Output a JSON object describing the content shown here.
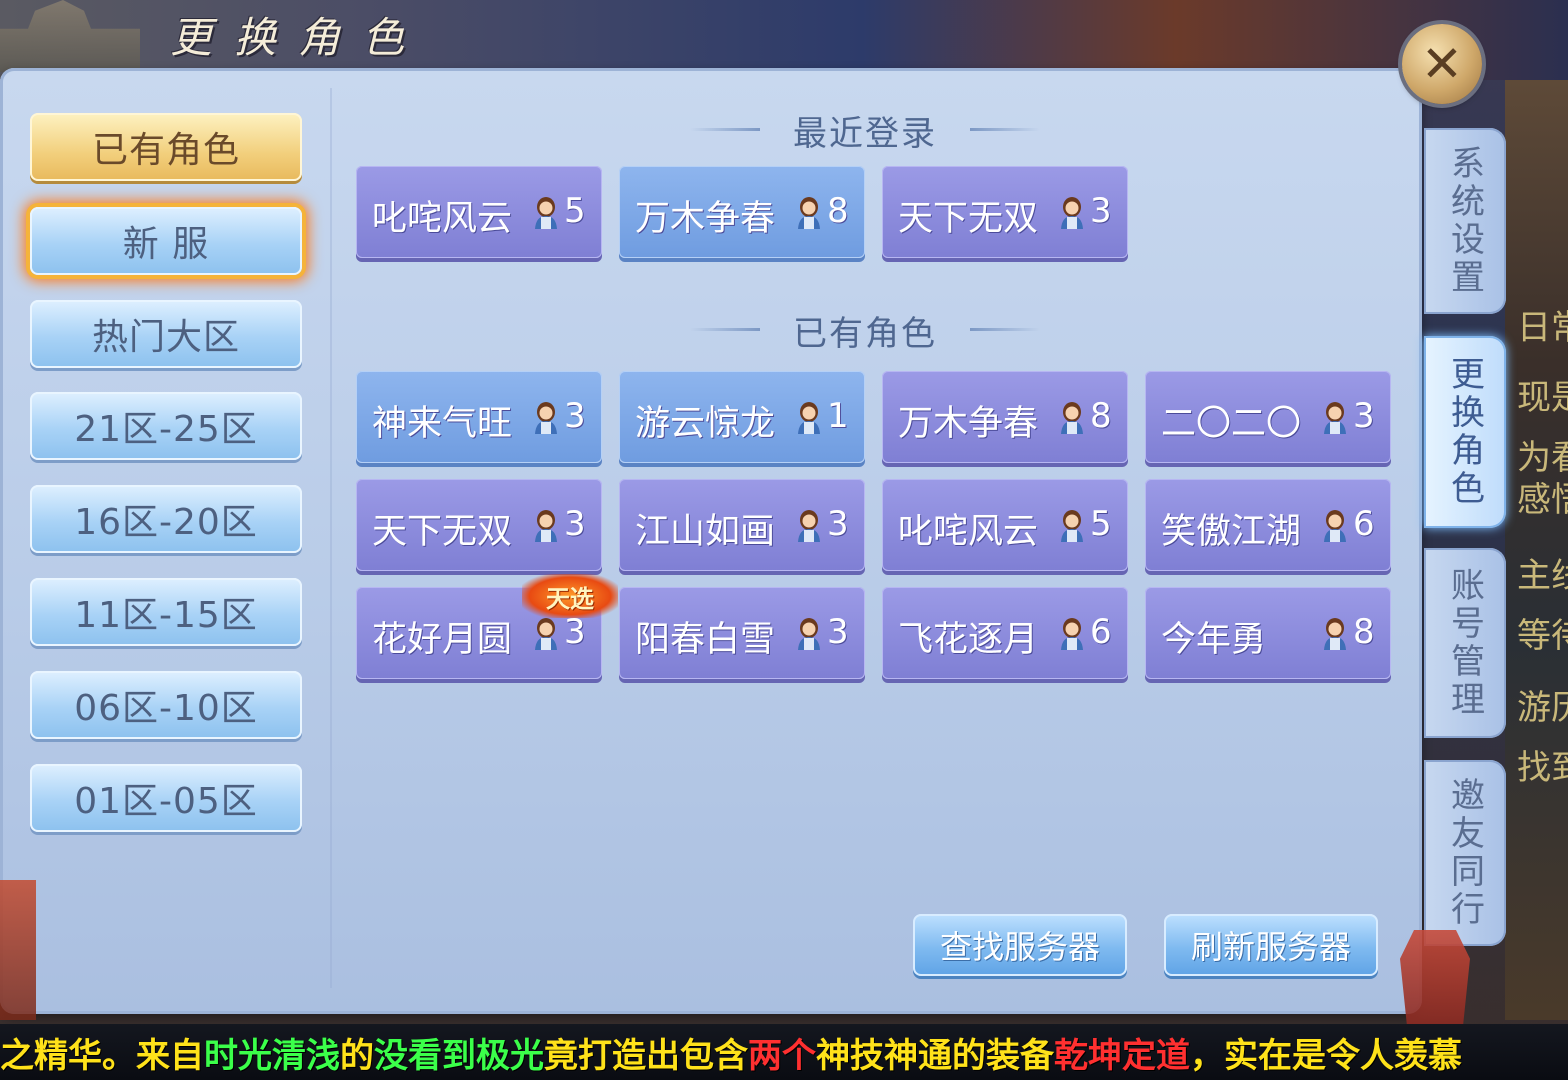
{
  "header": {
    "title": "更换角色",
    "close_label": "✕"
  },
  "left_menu": {
    "items": [
      {
        "label": "已有角色"
      },
      {
        "label": "新  服"
      },
      {
        "label": "热门大区"
      },
      {
        "label": "21区-25区"
      },
      {
        "label": "16区-20区"
      },
      {
        "label": "11区-15区"
      },
      {
        "label": "06区-10区"
      },
      {
        "label": "01区-05区"
      }
    ]
  },
  "recent": {
    "heading": "最近登录",
    "servers": [
      {
        "name": "叱咤风云",
        "count": "5"
      },
      {
        "name": "万木争春",
        "count": "8"
      },
      {
        "name": "天下无双",
        "count": "3"
      }
    ]
  },
  "existing": {
    "heading": "已有角色",
    "servers": [
      {
        "name": "神来气旺",
        "count": "3"
      },
      {
        "name": "游云惊龙",
        "count": "1"
      },
      {
        "name": "万木争春",
        "count": "8"
      },
      {
        "name": "二〇二〇",
        "count": "3"
      },
      {
        "name": "天下无双",
        "count": "3"
      },
      {
        "name": "江山如画",
        "count": "3"
      },
      {
        "name": "叱咤风云",
        "count": "5"
      },
      {
        "name": "笑傲江湖",
        "count": "6"
      },
      {
        "name": "花好月圆",
        "count": "3"
      },
      {
        "name": "阳春白雪",
        "count": "3"
      },
      {
        "name": "飞花逐月",
        "count": "6"
      },
      {
        "name": "今年勇",
        "count": "8"
      }
    ],
    "badge": "天选"
  },
  "actions": {
    "find_label": "查找服务器",
    "refresh_label": "刷新服务器"
  },
  "right_tabs": {
    "items": [
      {
        "label": "系统设置"
      },
      {
        "label": "更换角色"
      },
      {
        "label": "账号管理"
      },
      {
        "label": "邀友同行"
      }
    ]
  },
  "side_text": [
    "日常",
    "现是",
    "为看",
    "感悟",
    "主线",
    "等待",
    "游历",
    "找到"
  ],
  "ticker": {
    "segments": [
      {
        "text": "之精华。来自",
        "color": "#ffe21a"
      },
      {
        "text": "时光清浅",
        "color": "#3bff4a"
      },
      {
        "text": "的",
        "color": "#ffe21a"
      },
      {
        "text": "没看到极光",
        "color": "#3bff4a"
      },
      {
        "text": "竟打造出包含",
        "color": "#ffe21a"
      },
      {
        "text": "两个",
        "color": "#ff3030"
      },
      {
        "text": "神技神通的装备",
        "color": "#ffe21a"
      },
      {
        "text": "乾坤定道",
        "color": "#ff3030"
      },
      {
        "text": "，实在是令人羡慕",
        "color": "#ffe21a"
      }
    ]
  },
  "colors": {
    "panel_bg": "#bdd0ea",
    "server_purple": "#8d8ce0",
    "server_blue": "#7ea8e8",
    "active_gold": "#f2cf7c"
  },
  "icons": {
    "role": "role-avatar-icon",
    "close": "close-icon"
  }
}
